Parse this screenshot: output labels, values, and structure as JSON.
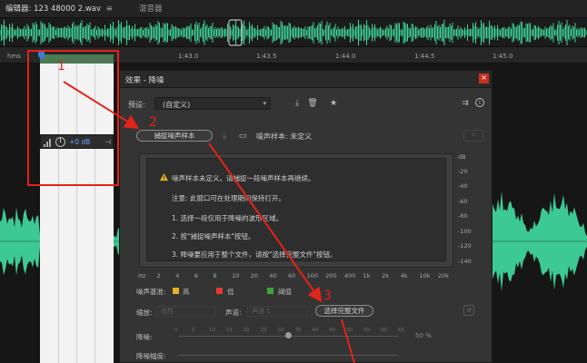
{
  "header": {
    "editor_tab": "编辑器: 123 48000 2.wav",
    "editor_menu_icon": "hamburger-icon",
    "mixer_tab": "混音器"
  },
  "ruler": {
    "unit": "hms",
    "ticks": [
      "1:43.0",
      "1:43.5",
      "1:44.0",
      "1:44.5",
      "1:45.0"
    ]
  },
  "hud": {
    "db_value": "+0 dB"
  },
  "annotations": {
    "n1": "1",
    "n2": "2",
    "n3": "3"
  },
  "dialog": {
    "title": "效果 - 降噪",
    "preset_label": "预设:",
    "preset_value": "(自定义)",
    "capture_button": "捕捉噪声样本",
    "profile_status": "噪声样本: 未定义",
    "graph_messages": [
      "噪声样本未定义。请捕捉一段噪声样本再继续。",
      "注意: 此窗口可在处理期间保持打开。",
      "1. 选择一段仅用于降噪的波形区域。",
      "2. 按\"捕捉噪声样本\"按钮。",
      "3. 降噪要应用于整个文件，请按\"选择完整文件\"按钮。"
    ],
    "db_ticks": [
      "dB",
      "-20",
      "-40",
      "-60",
      "-80",
      "-100",
      "-120",
      "-140"
    ],
    "hz_ticks": [
      "Hz",
      "2",
      "4",
      "6",
      "8",
      "10",
      "20",
      "40",
      "60",
      "100",
      "200",
      "400",
      "1k",
      "2k",
      "4k",
      "10k",
      "20k"
    ],
    "legend_label": "噪声基准:",
    "legend_high": "高",
    "legend_low": "低",
    "legend_threshold": "阈值",
    "legend_colors": {
      "high": "#e3b31c",
      "low": "#e03a2f",
      "threshold": "#3fa53a"
    },
    "scale_label": "缩放:",
    "scale_value": "线性",
    "channel_label": "声道:",
    "channel_value": "声道 1",
    "select_file_button": "选择完整文件",
    "noise_label": "降噪:",
    "noise_pct": "50 %",
    "noise_level": 0.5,
    "reduce_label": "降噪幅度:",
    "reduce_ticks": [
      "0",
      "5",
      "10",
      "15",
      "20",
      "25",
      "30",
      "35",
      "40",
      "45",
      "50",
      "55",
      "60",
      "65"
    ]
  },
  "colors": {
    "waveform": "#3fd39a",
    "accent": "#e2231a",
    "clip": "#4c7a55"
  }
}
